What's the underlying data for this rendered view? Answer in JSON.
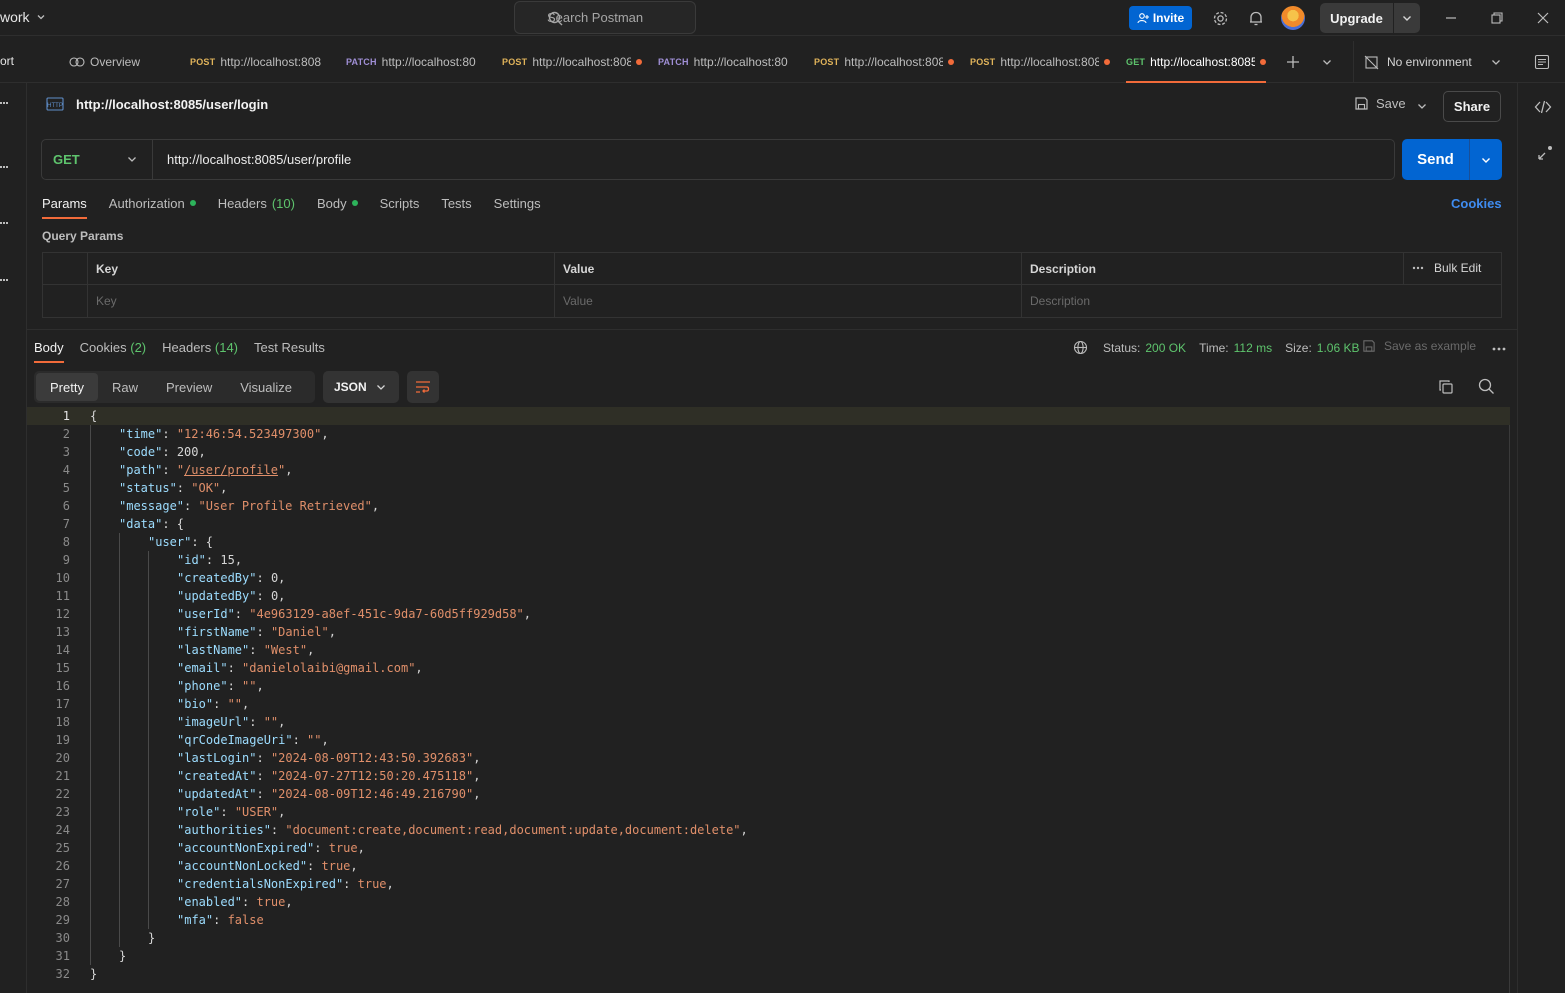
{
  "workspace": {
    "name": "work"
  },
  "search": {
    "placeholder": "Search Postman"
  },
  "header": {
    "invite_label": "Invite",
    "upgrade_label": "Upgrade"
  },
  "tabs": {
    "left_cut": "ort",
    "overview_label": "Overview",
    "items": [
      {
        "method": "POST",
        "url": "http://localhost:808",
        "dirty": false
      },
      {
        "method": "PATCH",
        "url": "http://localhost:80",
        "dirty": false
      },
      {
        "method": "POST",
        "url": "http://localhost:808",
        "dirty": true
      },
      {
        "method": "PATCH",
        "url": "http://localhost:80",
        "dirty": false
      },
      {
        "method": "POST",
        "url": "http://localhost:808",
        "dirty": true
      },
      {
        "method": "POST",
        "url": "http://localhost:808",
        "dirty": true
      },
      {
        "method": "GET",
        "url": "http://localhost:8085",
        "dirty": true,
        "active": true
      }
    ],
    "environment": "No environment"
  },
  "request": {
    "title": "http://localhost:8085/user/login",
    "save_label": "Save",
    "share_label": "Share",
    "method": "GET",
    "url": "http://localhost:8085/user/profile",
    "send_label": "Send",
    "tabs": {
      "params": "Params",
      "authorization": "Authorization",
      "headers": "Headers",
      "headers_count": "(10)",
      "body": "Body",
      "scripts": "Scripts",
      "tests": "Tests",
      "settings": "Settings"
    },
    "cookies_link": "Cookies",
    "query_params": {
      "title": "Query Params",
      "columns": {
        "key": "Key",
        "value": "Value",
        "description": "Description"
      },
      "bulk_edit": "Bulk Edit",
      "placeholders": {
        "key": "Key",
        "value": "Value",
        "description": "Description"
      }
    }
  },
  "response": {
    "tabs": {
      "body": "Body",
      "cookies": "Cookies",
      "cookies_count": "(2)",
      "headers": "Headers",
      "headers_count": "(14)",
      "test_results": "Test Results"
    },
    "status_label": "Status:",
    "status_value": "200 OK",
    "time_label": "Time:",
    "time_value": "112 ms",
    "size_label": "Size:",
    "size_value": "1.06 KB",
    "save_example": "Save as example",
    "views": {
      "pretty": "Pretty",
      "raw": "Raw",
      "preview": "Preview",
      "visualize": "Visualize"
    },
    "format": "JSON",
    "body_lines": [
      [
        [
          "p",
          "{"
        ]
      ],
      [
        [
          "k",
          "\"time\""
        ],
        [
          "p",
          ": "
        ],
        [
          "s",
          "\"12:46:54.523497300\""
        ],
        [
          "p",
          ","
        ]
      ],
      [
        [
          "k",
          "\"code\""
        ],
        [
          "p",
          ": "
        ],
        [
          "n",
          "200"
        ],
        [
          "p",
          ","
        ]
      ],
      [
        [
          "k",
          "\"path\""
        ],
        [
          "p",
          ": "
        ],
        [
          "s",
          "\""
        ],
        [
          "u",
          "/user/profile"
        ],
        [
          "s",
          "\""
        ],
        [
          "p",
          ","
        ]
      ],
      [
        [
          "k",
          "\"status\""
        ],
        [
          "p",
          ": "
        ],
        [
          "s",
          "\"OK\""
        ],
        [
          "p",
          ","
        ]
      ],
      [
        [
          "k",
          "\"message\""
        ],
        [
          "p",
          ": "
        ],
        [
          "s",
          "\"User Profile Retrieved\""
        ],
        [
          "p",
          ","
        ]
      ],
      [
        [
          "k",
          "\"data\""
        ],
        [
          "p",
          ": {"
        ]
      ],
      [
        [
          "k",
          "\"user\""
        ],
        [
          "p",
          ": {"
        ]
      ],
      [
        [
          "k",
          "\"id\""
        ],
        [
          "p",
          ": "
        ],
        [
          "n",
          "15"
        ],
        [
          "p",
          ","
        ]
      ],
      [
        [
          "k",
          "\"createdBy\""
        ],
        [
          "p",
          ": "
        ],
        [
          "n",
          "0"
        ],
        [
          "p",
          ","
        ]
      ],
      [
        [
          "k",
          "\"updatedBy\""
        ],
        [
          "p",
          ": "
        ],
        [
          "n",
          "0"
        ],
        [
          "p",
          ","
        ]
      ],
      [
        [
          "k",
          "\"userId\""
        ],
        [
          "p",
          ": "
        ],
        [
          "s",
          "\"4e963129-a8ef-451c-9da7-60d5ff929d58\""
        ],
        [
          "p",
          ","
        ]
      ],
      [
        [
          "k",
          "\"firstName\""
        ],
        [
          "p",
          ": "
        ],
        [
          "s",
          "\"Daniel\""
        ],
        [
          "p",
          ","
        ]
      ],
      [
        [
          "k",
          "\"lastName\""
        ],
        [
          "p",
          ": "
        ],
        [
          "s",
          "\"West\""
        ],
        [
          "p",
          ","
        ]
      ],
      [
        [
          "k",
          "\"email\""
        ],
        [
          "p",
          ": "
        ],
        [
          "s",
          "\"danielolaibi@gmail.com\""
        ],
        [
          "p",
          ","
        ]
      ],
      [
        [
          "k",
          "\"phone\""
        ],
        [
          "p",
          ": "
        ],
        [
          "s",
          "\"\""
        ],
        [
          "p",
          ","
        ]
      ],
      [
        [
          "k",
          "\"bio\""
        ],
        [
          "p",
          ": "
        ],
        [
          "s",
          "\"\""
        ],
        [
          "p",
          ","
        ]
      ],
      [
        [
          "k",
          "\"imageUrl\""
        ],
        [
          "p",
          ": "
        ],
        [
          "s",
          "\"\""
        ],
        [
          "p",
          ","
        ]
      ],
      [
        [
          "k",
          "\"qrCodeImageUri\""
        ],
        [
          "p",
          ": "
        ],
        [
          "s",
          "\"\""
        ],
        [
          "p",
          ","
        ]
      ],
      [
        [
          "k",
          "\"lastLogin\""
        ],
        [
          "p",
          ": "
        ],
        [
          "s",
          "\"2024-08-09T12:43:50.392683\""
        ],
        [
          "p",
          ","
        ]
      ],
      [
        [
          "k",
          "\"createdAt\""
        ],
        [
          "p",
          ": "
        ],
        [
          "s",
          "\"2024-07-27T12:50:20.475118\""
        ],
        [
          "p",
          ","
        ]
      ],
      [
        [
          "k",
          "\"updatedAt\""
        ],
        [
          "p",
          ": "
        ],
        [
          "s",
          "\"2024-08-09T12:46:49.216790\""
        ],
        [
          "p",
          ","
        ]
      ],
      [
        [
          "k",
          "\"role\""
        ],
        [
          "p",
          ": "
        ],
        [
          "s",
          "\"USER\""
        ],
        [
          "p",
          ","
        ]
      ],
      [
        [
          "k",
          "\"authorities\""
        ],
        [
          "p",
          ": "
        ],
        [
          "s",
          "\"document:create,document:read,document:update,document:delete\""
        ],
        [
          "p",
          ","
        ]
      ],
      [
        [
          "k",
          "\"accountNonExpired\""
        ],
        [
          "p",
          ": "
        ],
        [
          "b",
          "true"
        ],
        [
          "p",
          ","
        ]
      ],
      [
        [
          "k",
          "\"accountNonLocked\""
        ],
        [
          "p",
          ": "
        ],
        [
          "b",
          "true"
        ],
        [
          "p",
          ","
        ]
      ],
      [
        [
          "k",
          "\"credentialsNonExpired\""
        ],
        [
          "p",
          ": "
        ],
        [
          "b",
          "true"
        ],
        [
          "p",
          ","
        ]
      ],
      [
        [
          "k",
          "\"enabled\""
        ],
        [
          "p",
          ": "
        ],
        [
          "b",
          "true"
        ],
        [
          "p",
          ","
        ]
      ],
      [
        [
          "k",
          "\"mfa\""
        ],
        [
          "p",
          ": "
        ],
        [
          "b",
          "false"
        ]
      ],
      [
        [
          "p",
          "}"
        ]
      ],
      [
        [
          "p",
          "}"
        ]
      ],
      [
        [
          "p",
          "}"
        ]
      ]
    ],
    "body_indent": [
      0,
      1,
      1,
      1,
      1,
      1,
      1,
      2,
      3,
      3,
      3,
      3,
      3,
      3,
      3,
      3,
      3,
      3,
      3,
      3,
      3,
      3,
      3,
      3,
      3,
      3,
      3,
      3,
      3,
      2,
      1,
      0
    ]
  },
  "colors": {
    "accent": "#f26b3a",
    "primary": "#0265d2",
    "success": "#5ec46d"
  }
}
